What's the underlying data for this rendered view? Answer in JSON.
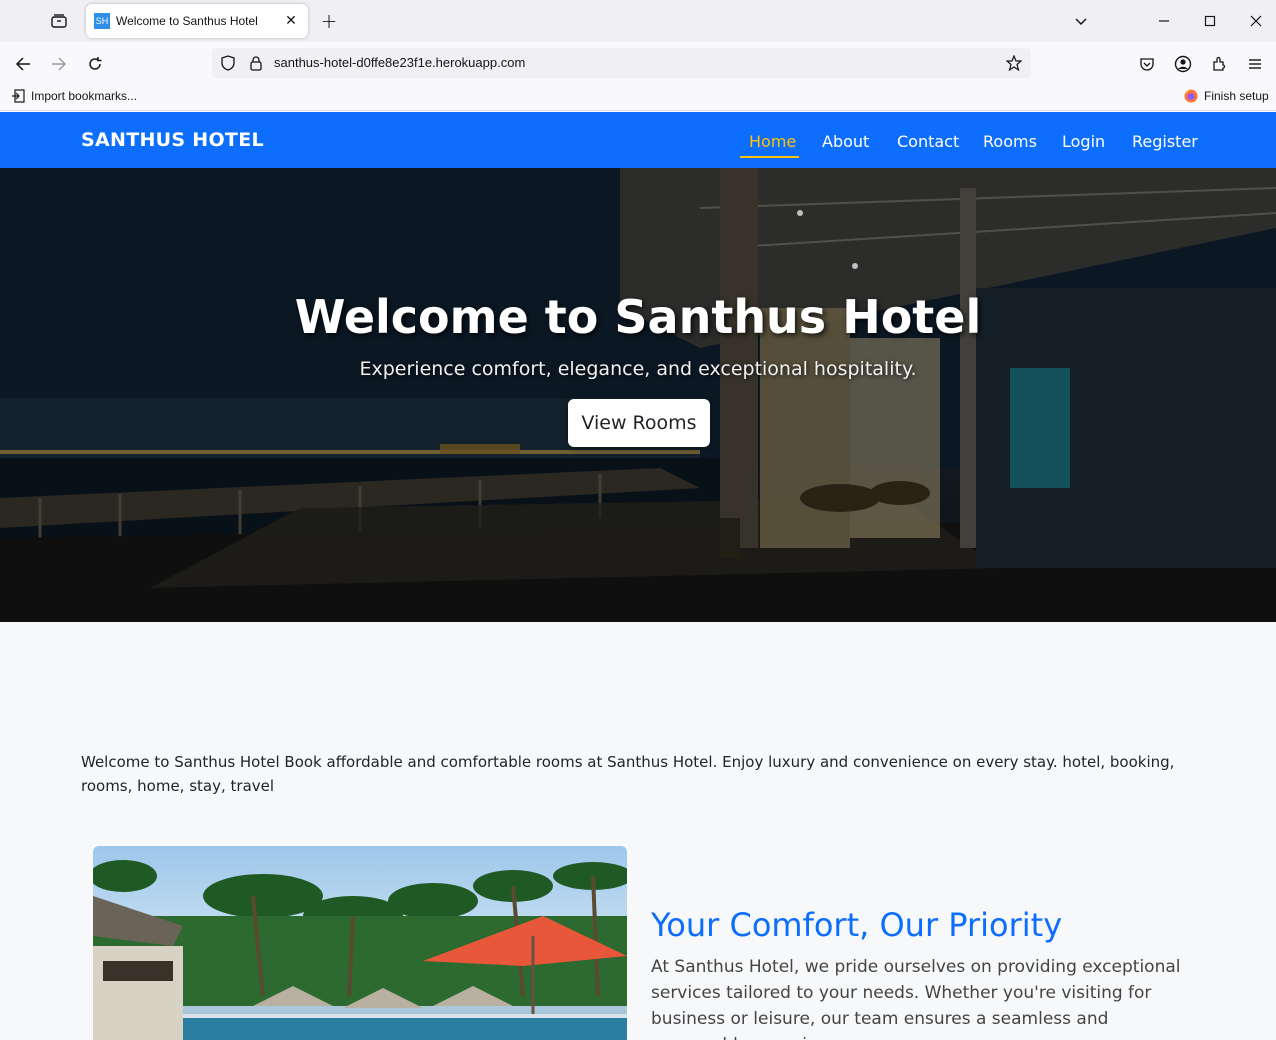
{
  "browser": {
    "tab_title": "Welcome to Santhus Hotel",
    "favicon_text": "SH",
    "url": "santhus-hotel-d0ffe8e23f1e.herokuapp.com",
    "bookmark_import": "Import bookmarks...",
    "finish_setup": "Finish setup"
  },
  "nav": {
    "brand": "SANTHUS HOTEL",
    "links": [
      "Home",
      "About",
      "Contact",
      "Rooms",
      "Login",
      "Register"
    ],
    "active": "Home",
    "color": "#0d6efd",
    "active_color": "#ffc107"
  },
  "hero": {
    "title": "Welcome to Santhus Hotel",
    "subtitle": "Experience comfort, elegance, and exceptional hospitality.",
    "button": "View Rooms"
  },
  "intro": {
    "text": "Welcome to Santhus Hotel Book affordable and comfortable rooms at Santhus Hotel. Enjoy luxury and convenience on every stay. hotel, booking, rooms, home, stay, travel"
  },
  "comfort": {
    "title": "Your Comfort, Our Priority",
    "text": "At Santhus Hotel, we pride ourselves on providing exceptional services tailored to your needs. Whether you're visiting for business or leisure, our team ensures a seamless and memorable experience"
  }
}
